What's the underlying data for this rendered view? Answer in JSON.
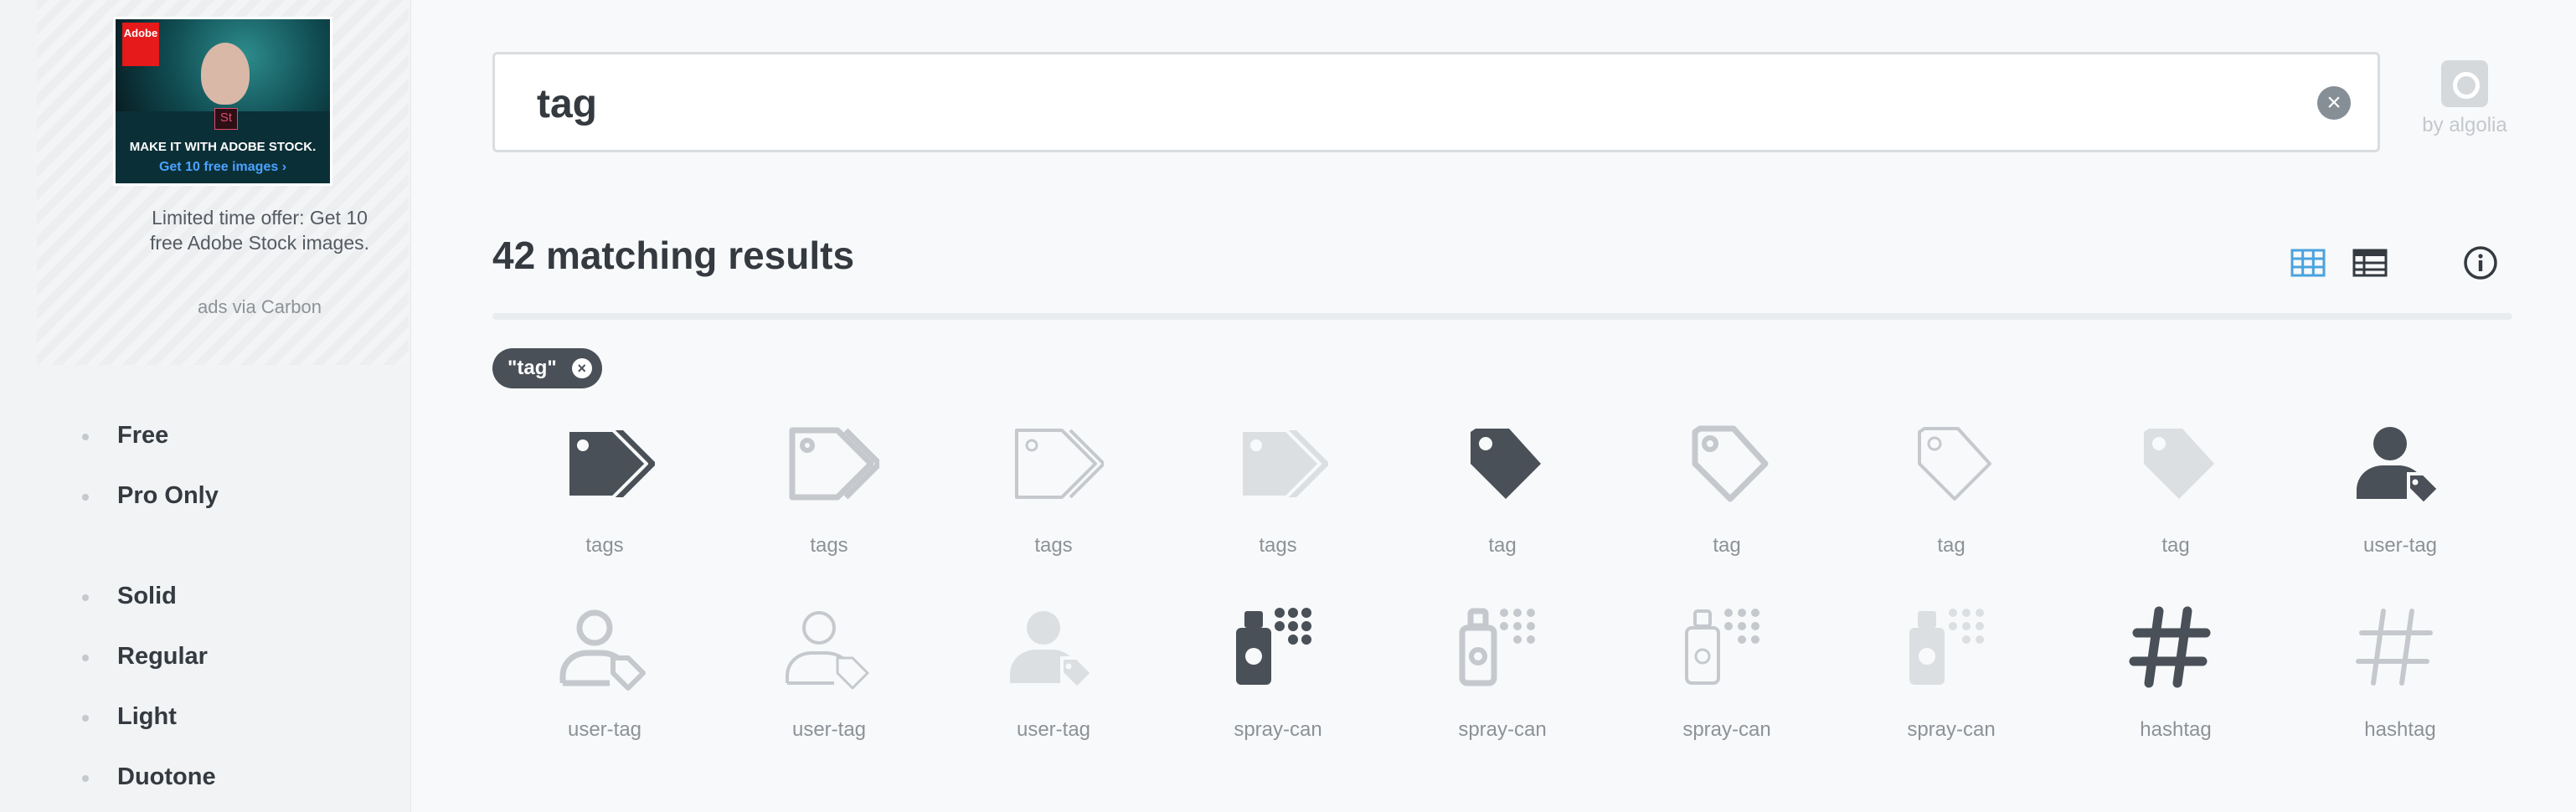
{
  "ad": {
    "brand": "Adobe",
    "badge": "St",
    "headline": "MAKE IT WITH ADOBE STOCK.",
    "cta": "Get 10 free images ›",
    "text": "Limited time offer: Get 10 free Adobe Stock images.",
    "via": "ads via Carbon"
  },
  "filters": {
    "license": [
      "Free",
      "Pro Only"
    ],
    "styles": [
      "Solid",
      "Regular",
      "Light",
      "Duotone"
    ]
  },
  "search": {
    "value": "tag",
    "clear_label": "×",
    "by": "by algolia"
  },
  "results": {
    "title": "42 matching results",
    "chip": "\"tag\"",
    "chip_clear": "×"
  },
  "colors": {
    "dark": "#495057",
    "mid": "#c5c9cd",
    "light": "#dcdfe2",
    "accent": "#4aa3df"
  },
  "icons": [
    {
      "name": "tags",
      "glyph": "tags",
      "style": "solid"
    },
    {
      "name": "tags",
      "glyph": "tags",
      "style": "regular"
    },
    {
      "name": "tags",
      "glyph": "tags",
      "style": "light"
    },
    {
      "name": "tags",
      "glyph": "tags",
      "style": "duotone"
    },
    {
      "name": "tag",
      "glyph": "tag",
      "style": "solid"
    },
    {
      "name": "tag",
      "glyph": "tag",
      "style": "regular"
    },
    {
      "name": "tag",
      "glyph": "tag",
      "style": "light"
    },
    {
      "name": "tag",
      "glyph": "tag",
      "style": "duotone"
    },
    {
      "name": "user-tag",
      "glyph": "user-tag",
      "style": "solid"
    },
    {
      "name": "user-tag",
      "glyph": "user-tag",
      "style": "regular"
    },
    {
      "name": "user-tag",
      "glyph": "user-tag",
      "style": "light"
    },
    {
      "name": "user-tag",
      "glyph": "user-tag",
      "style": "duotone"
    },
    {
      "name": "spray-can",
      "glyph": "spray-can",
      "style": "solid"
    },
    {
      "name": "spray-can",
      "glyph": "spray-can",
      "style": "regular"
    },
    {
      "name": "spray-can",
      "glyph": "spray-can",
      "style": "light"
    },
    {
      "name": "spray-can",
      "glyph": "spray-can",
      "style": "duotone"
    },
    {
      "name": "hashtag",
      "glyph": "hashtag",
      "style": "solid"
    },
    {
      "name": "hashtag",
      "glyph": "hashtag",
      "style": "light"
    }
  ]
}
